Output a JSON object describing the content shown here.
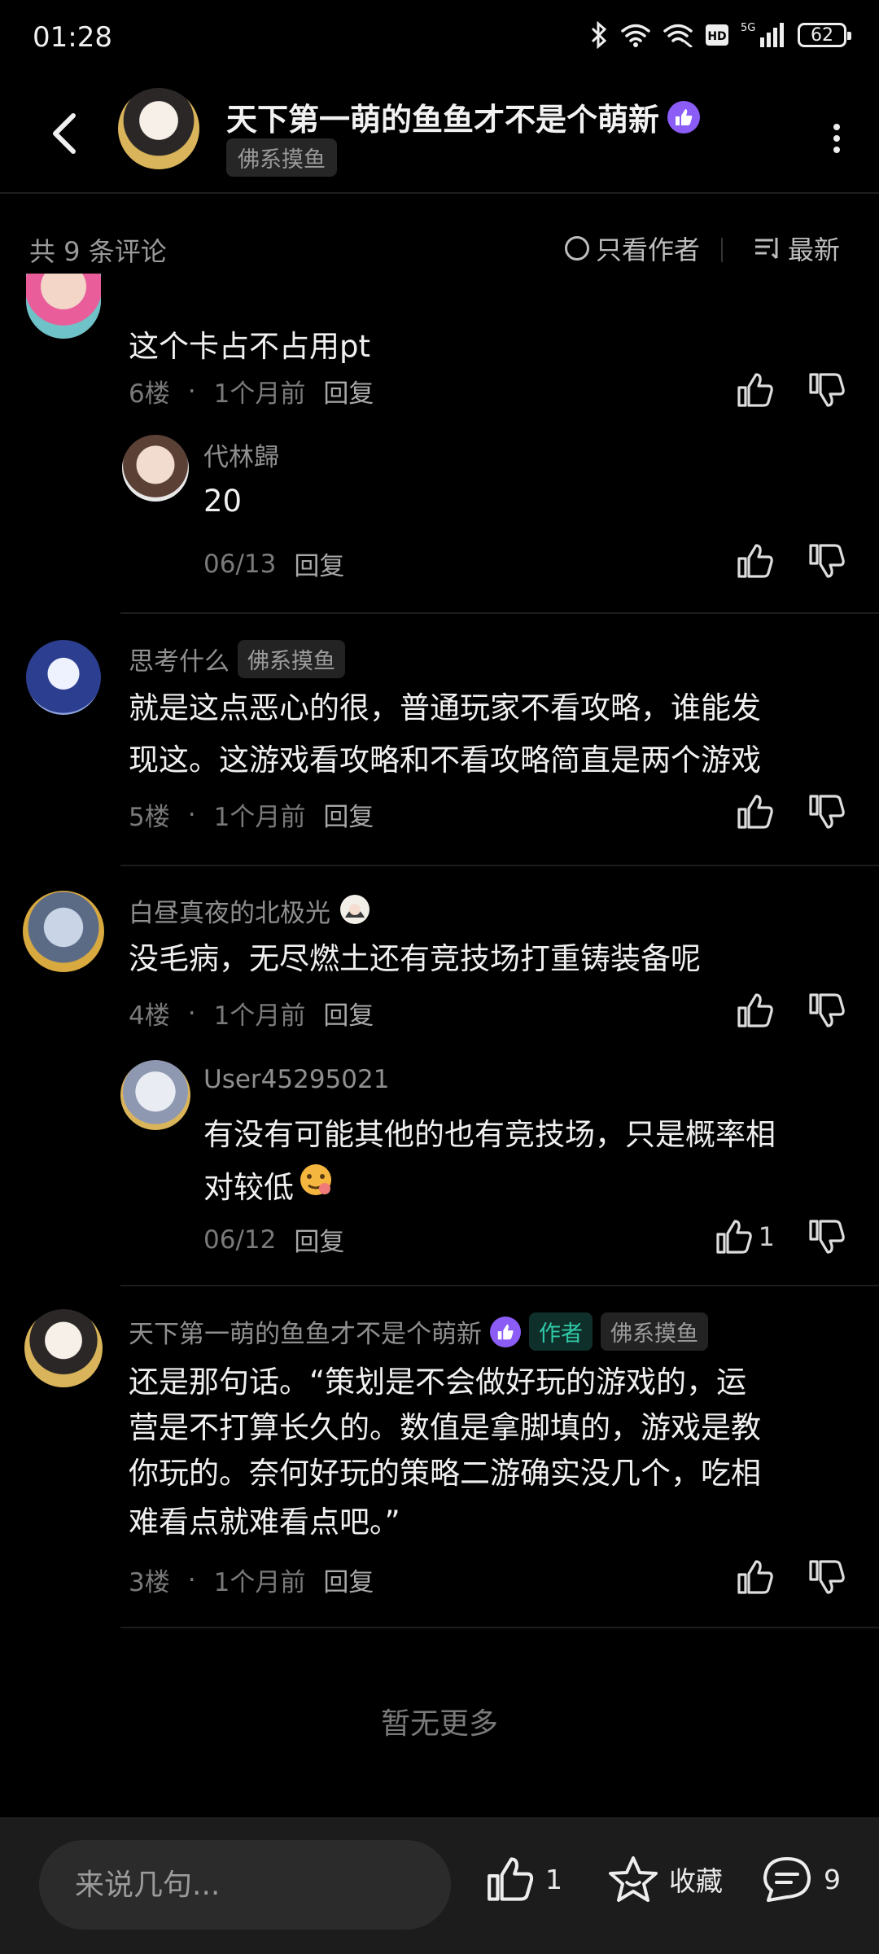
{
  "status": {
    "time": "01:28",
    "battery": "62"
  },
  "header": {
    "title": "天下第一萌的鱼鱼才不是个萌新",
    "tag": "佛系摸鱼"
  },
  "sort_bar": {
    "count": "共 9 条评论",
    "only_author": "只看作者",
    "latest": "最新"
  },
  "comments": [
    {
      "text": "这个卡占不占用pt",
      "floor": "6楼",
      "time": "1个月前",
      "reply": "回复",
      "sub": {
        "username": "代林歸",
        "text": "20",
        "time": "06/13",
        "reply": "回复"
      }
    },
    {
      "username": "思考什么",
      "tag": "佛系摸鱼",
      "text_lines": [
        "就是这点恶心的很，普通玩家不看攻略，谁能发",
        "现这。这游戏看攻略和不看攻略简直是两个游戏"
      ],
      "floor": "5楼",
      "time": "1个月前",
      "reply": "回复"
    },
    {
      "username": "白昼真夜的北极光",
      "text": "没毛病，无尽燃土还有竞技场打重铸装备呢",
      "floor": "4楼",
      "time": "1个月前",
      "reply": "回复",
      "sub": {
        "username": "User45295021",
        "text_lines": [
          "有没有可能其他的也有竞技场，只是概率相",
          "对较低"
        ],
        "time": "06/12",
        "reply": "回复",
        "likes": "1"
      }
    },
    {
      "username": "天下第一萌的鱼鱼才不是个萌新",
      "author_tag": "作者",
      "tag": "佛系摸鱼",
      "text_lines": [
        "还是那句话。“策划是不会做好玩的游戏的，运",
        "营是不打算长久的。数值是拿脚填的，游戏是教",
        "你玩的。奈何好玩的策略二游确实没几个，吃相",
        "难看点就难看点吧。”"
      ],
      "floor": "3楼",
      "time": "1个月前",
      "reply": "回复"
    }
  ],
  "no_more": "暂无更多",
  "bottom_bar": {
    "input_placeholder": "来说几句...",
    "like_count": "1",
    "collect_label": "收藏",
    "comment_count": "9"
  }
}
